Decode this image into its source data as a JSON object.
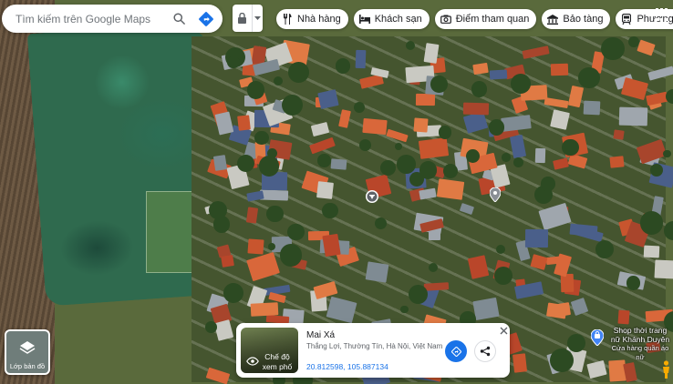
{
  "search": {
    "placeholder": "Tìm kiếm trên Google Maps"
  },
  "chips": [
    {
      "icon": "restaurant-icon",
      "label": "Nhà hàng"
    },
    {
      "icon": "hotel-icon",
      "label": "Khách sạn"
    },
    {
      "icon": "camera-icon",
      "label": "Điểm tham quan"
    },
    {
      "icon": "museum-icon",
      "label": "Bảo tàng"
    },
    {
      "icon": "transit-icon",
      "label": "Phương"
    }
  ],
  "card": {
    "title": "Mai Xá",
    "address": "Thắng Lợi, Thường Tín, Hà Nội, Việt Nam",
    "coordinates": "20.812598, 105.887134",
    "thumbnail_label": "Chế độ xem phố"
  },
  "layers": {
    "label": "Lớp bản đồ"
  },
  "poi": {
    "name": "Shop thời trang nữ Khánh Duyên",
    "subtitle": "Cửa hàng quần áo nữ"
  },
  "colors": {
    "accent": "#1a73e8",
    "pin": "#4285f4"
  }
}
